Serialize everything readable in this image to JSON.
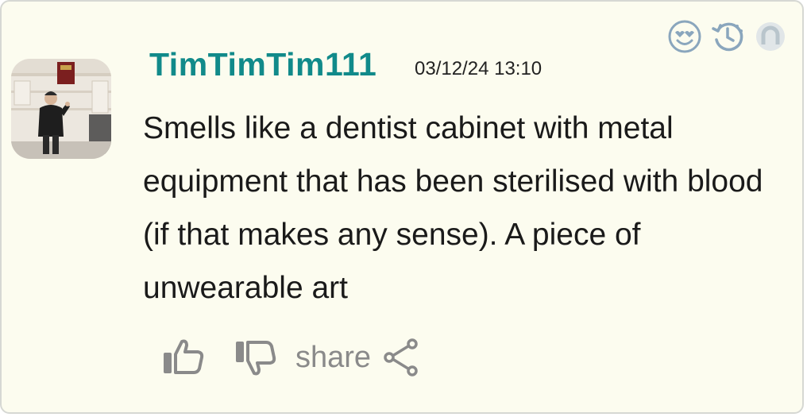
{
  "comment": {
    "author": "TimTimTim111",
    "timestamp": "03/12/24 13:10",
    "text": "Smells like a dentist cabinet with metal equipment that has been sterilised with blood (if that makes any sense). A piece of unwearable art"
  },
  "top_icons": [
    "love-emoji-icon",
    "history-clock-icon",
    "user-placeholder-icon"
  ],
  "actions": {
    "share_label": "share",
    "icons": [
      "thumbs-up-icon",
      "thumbs-down-icon",
      "share-icon"
    ]
  },
  "colors": {
    "card_background": "#fcfcef",
    "author": "#118a8a",
    "icon_blue": "#8aa6bd",
    "action_gray": "#8a8a8a"
  }
}
